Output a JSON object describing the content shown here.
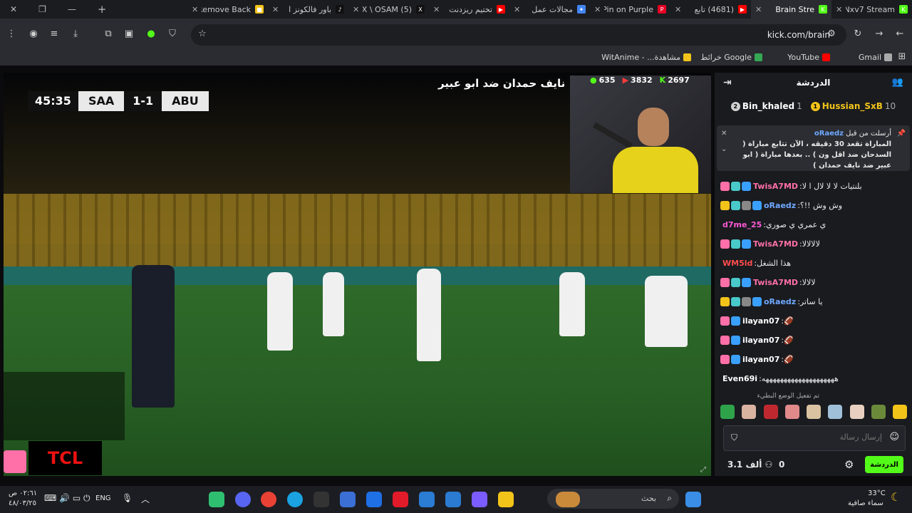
{
  "tabs": [
    {
      "title": "Nxv7 Stream",
      "fav_color": "#53fc18",
      "fav_glyph": "K"
    },
    {
      "title": "Brain Stre",
      "fav_color": "#53fc18",
      "fav_glyph": "K",
      "active": true
    },
    {
      "title": "(4681) تابع",
      "fav_color": "#ff0000",
      "fav_glyph": "▶"
    },
    {
      "title": "Pin on Purple",
      "fav_color": "#e60023",
      "fav_glyph": "P"
    },
    {
      "title": "مجالات عمل",
      "fav_color": "#4285f4",
      "fav_glyph": "✦"
    },
    {
      "title": "تختيم ريزدنت",
      "fav_color": "#ff0000",
      "fav_glyph": "▶"
    },
    {
      "title": "(5) X \\ OSAM",
      "fav_color": "#111111",
      "fav_glyph": "X"
    },
    {
      "title": "باور فالكونز ا",
      "fav_color": "#111111",
      "fav_glyph": "♪"
    },
    {
      "title": "Remove Back",
      "fav_color": "#f2c41a",
      "fav_glyph": "■"
    }
  ],
  "address_bar": {
    "url": "kick.com/brain"
  },
  "bookmarks": [
    {
      "label": "Gmail",
      "color": "#aaaaaa"
    },
    {
      "label": "YouTube",
      "color": "#ff0000"
    },
    {
      "label": "Google خرائط",
      "color": "#34a853"
    },
    {
      "label": "مشاهدة... - WitAnime",
      "color": "#f2c41a"
    }
  ],
  "player": {
    "scoreboard": {
      "time": "45:35",
      "home": "SAA",
      "score": "1-1",
      "away": "ABU"
    },
    "caption": "نايف حمدان ضد ابو عبير",
    "stats": [
      "635",
      "3832",
      "2697"
    ],
    "brand": "TCL"
  },
  "chat": {
    "title": "الدردشة",
    "leaderboard": [
      {
        "rank": "1",
        "name": "Hussian_SxB",
        "count": "10",
        "color": "#f2c41a"
      },
      {
        "rank": "2",
        "name": "Bin_khaled",
        "count": "1",
        "color": "#d0d0d0"
      }
    ],
    "pinned": {
      "label": "أرسلت من قبل",
      "user": "oRaedz",
      "text": "المباراة تقعد 30 دقيقه ، الآن تتابع مباراة ( السدحان ضد اقل ون ) .. بعدها مباراة ( ابو عبير ضد نايف حمدان )"
    },
    "messages": [
      {
        "user": "TwisA7MD",
        "color": "#ff6fa8",
        "text": "بلنتيات لا لا لال ا لا",
        "badges": [
          "#ff6fa8",
          "#49c9c9",
          "#3aa0ff"
        ]
      },
      {
        "user": "oRaedz",
        "color": "#6fa8ff",
        "text": "وش وش !!؟",
        "badges": [
          "#f2c41a",
          "#49c9c9",
          "#888888",
          "#3aa0ff"
        ]
      },
      {
        "user": "d7me_25",
        "color": "#ff5ad6",
        "text": "ي عمري ي صوري",
        "badges": []
      },
      {
        "user": "TwisA7MD",
        "color": "#ff6fa8",
        "text": "لالالالا",
        "badges": [
          "#ff6fa8",
          "#49c9c9",
          "#3aa0ff"
        ]
      },
      {
        "user": "WM5ld",
        "color": "#ff4d4d",
        "text": "هذا الشغل",
        "badges": []
      },
      {
        "user": "TwisA7MD",
        "color": "#ff6fa8",
        "text": "لالالا",
        "badges": [
          "#ff6fa8",
          "#49c9c9",
          "#3aa0ff"
        ]
      },
      {
        "user": "oRaedz",
        "color": "#6fa8ff",
        "text": "يا ساتر",
        "badges": [
          "#f2c41a",
          "#49c9c9",
          "#888888",
          "#3aa0ff"
        ]
      },
      {
        "user": "ilayan07",
        "color": "#ffffff",
        "text": "🏈",
        "badges": [
          "#ff6fa8",
          "#3aa0ff"
        ]
      },
      {
        "user": "ilayan07",
        "color": "#ffffff",
        "text": "🏈",
        "badges": [
          "#ff6fa8",
          "#3aa0ff"
        ]
      },
      {
        "user": "ilayan07",
        "color": "#ffffff",
        "text": "🏈",
        "badges": [
          "#ff6fa8",
          "#3aa0ff"
        ]
      },
      {
        "user": "Even69i",
        "color": "#ffffff",
        "text": "ههههههههههههههههههههه",
        "badges": []
      }
    ],
    "emote_hint": "تم تفعيل الوضع البطيء",
    "input_placeholder": "إرسال رسالة",
    "send_label": "الدردشة",
    "points": "0",
    "viewers": "3.1 ألف"
  },
  "taskbar": {
    "search_placeholder": "بحث",
    "language": "ENG",
    "time": "٠٢:٦١ ص",
    "date": "٤٨/٠٣/٢٥",
    "weather_temp": "33°C",
    "weather_desc": "سماء صافية"
  }
}
